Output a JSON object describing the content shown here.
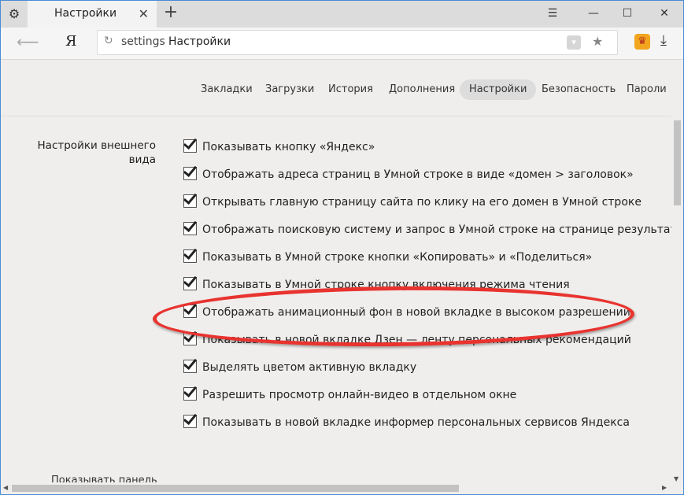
{
  "tab": {
    "title": "Настройки"
  },
  "address": {
    "scheme": "settings",
    "title": "Настройки"
  },
  "logo": "Я",
  "nav": [
    {
      "label": "Закладки"
    },
    {
      "label": "Загрузки"
    },
    {
      "label": "История"
    },
    {
      "label": "Дополнения"
    },
    {
      "label": "Настройки",
      "active": true
    },
    {
      "label": "Безопасность"
    },
    {
      "label": "Пароли"
    }
  ],
  "section": {
    "label": "Настройки внешнего вида"
  },
  "options": [
    {
      "label": "Показывать кнопку «Яндекс»",
      "checked": true
    },
    {
      "label": "Отображать адреса страниц в Умной строке в виде «домен > заголовок»",
      "checked": true
    },
    {
      "label": "Открывать главную страницу сайта по клику на его домен в Умной строке",
      "checked": true
    },
    {
      "label": "Отображать поисковую систему и запрос в Умной строке на странице результатов по",
      "checked": true
    },
    {
      "label": "Показывать в Умной строке кнопки «Копировать» и «Поделиться»",
      "checked": true
    },
    {
      "label": "Показывать в Умной строке кнопку включения режима чтения",
      "checked": true
    },
    {
      "label": "Отображать анимационный фон в новой вкладке в высоком разрешении",
      "checked": true
    },
    {
      "label": "Показывать в новой вкладке Дзен — ленту персональных рекомендаций",
      "checked": true
    },
    {
      "label": "Выделять цветом активную вкладку",
      "checked": true
    },
    {
      "label": "Разрешить просмотр онлайн-видео в отдельном окне",
      "checked": true
    },
    {
      "label": "Показывать в новой вкладке информер персональных сервисов Яндекса",
      "checked": true
    }
  ],
  "next_section": {
    "label": "Показывать панель"
  },
  "colors": {
    "highlight_oval": "#e8332f",
    "accent_border": "#4a8bd6"
  }
}
